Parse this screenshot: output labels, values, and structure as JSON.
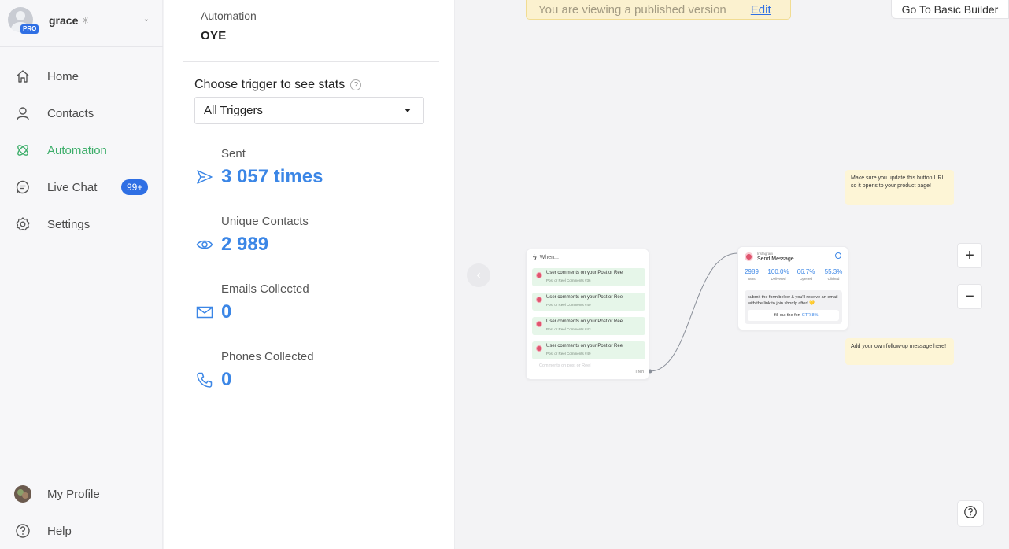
{
  "sidebar": {
    "account": {
      "name": "grace",
      "plan_badge": "PRO"
    },
    "nav": [
      {
        "label": "Home",
        "icon": "home-icon"
      },
      {
        "label": "Contacts",
        "icon": "person-icon"
      },
      {
        "label": "Automation",
        "icon": "automation-icon",
        "active": true
      },
      {
        "label": "Live Chat",
        "icon": "chat-icon",
        "badge": "99+"
      },
      {
        "label": "Settings",
        "icon": "gear-icon"
      }
    ],
    "footer": [
      {
        "label": "My Profile",
        "icon": "profile-avatar"
      },
      {
        "label": "Help",
        "icon": "question-icon"
      }
    ]
  },
  "panel": {
    "breadcrumb": "Automation",
    "automation_name": "OYE",
    "choose_label": "Choose trigger to see stats",
    "trigger_select": "All Triggers",
    "stats": [
      {
        "label": "Sent",
        "value": "3 057 times",
        "icon": "send-icon"
      },
      {
        "label": "Unique Contacts",
        "value": "2 989",
        "icon": "eye-icon"
      },
      {
        "label": "Emails Collected",
        "value": "0",
        "icon": "mail-icon"
      },
      {
        "label": "Phones Collected",
        "value": "0",
        "icon": "phone-icon"
      }
    ]
  },
  "canvas": {
    "published_msg": "You are viewing a published version",
    "edit_link": "Edit",
    "basic_builder": "Go To Basic Builder",
    "zoom_in": "+",
    "zoom_out": "−",
    "when_node": {
      "title": "When...",
      "triggers": [
        {
          "title": "User comments on your Post or Reel",
          "sub": "Post or Reel Comments #36"
        },
        {
          "title": "User comments on your Post or Reel",
          "sub": "Post or Reel Comments #40"
        },
        {
          "title": "User comments on your Post or Reel",
          "sub": "Post or Reel Comments #43"
        },
        {
          "title": "User comments on your Post or Reel",
          "sub": "Post or Reel Comments #49"
        }
      ],
      "ghost": "Comments on post or Reel",
      "then": "Then"
    },
    "send_node": {
      "platform": "Instagram",
      "title": "Send Message",
      "metrics": [
        {
          "value": "2989",
          "label": "Sent"
        },
        {
          "value": "100.0%",
          "label": "Delivered"
        },
        {
          "value": "66.7%",
          "label": "Opened"
        },
        {
          "value": "55.3%",
          "label": "Clicked"
        }
      ],
      "message": "submit the form below & you'll receive an email with the link to join shortly after! 💛",
      "button": "fill out the fon",
      "ctr": "CTR 8%"
    },
    "notes": [
      "Make sure you update this button URL so it opens to your product page!",
      "Add your own follow-up message here!"
    ]
  },
  "colors": {
    "accent": "#3b86e6",
    "active_nav": "#3dae6a",
    "badge": "#2f6fe4",
    "banner": "#fbf1cf"
  }
}
